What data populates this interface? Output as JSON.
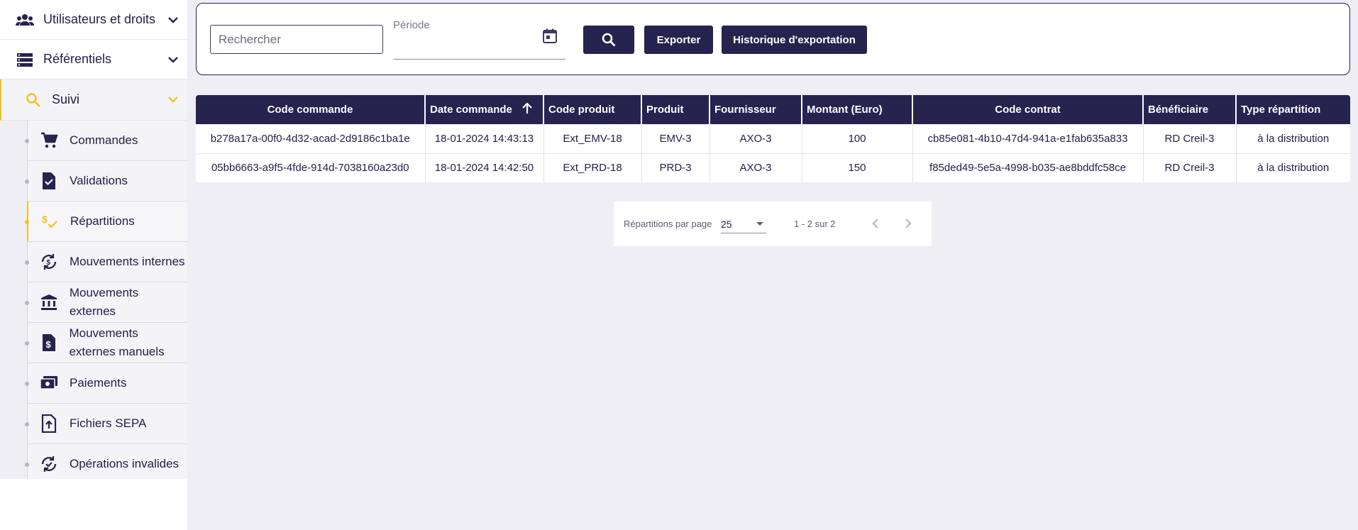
{
  "sidebar": {
    "groups": [
      {
        "label": "Utilisateurs et droits",
        "icon": "users-icon"
      },
      {
        "label": "Référentiels",
        "icon": "list-icon"
      },
      {
        "label": "Suivi",
        "icon": "search-icon"
      }
    ],
    "items": [
      {
        "label": "Commandes",
        "icon": "cart-icon"
      },
      {
        "label": "Validations",
        "icon": "document-check-icon"
      },
      {
        "label": "Répartitions",
        "icon": "distribution-icon"
      },
      {
        "label": "Mouvements internes",
        "icon": "exchange-icon"
      },
      {
        "label": "Mouvements externes",
        "icon": "bank-icon"
      },
      {
        "label": "Mouvements externes manuels",
        "icon": "money-file-icon"
      },
      {
        "label": "Paiements",
        "icon": "payment-icon"
      },
      {
        "label": "Fichiers SEPA",
        "icon": "file-upload-icon"
      },
      {
        "label": "Opérations invalides",
        "icon": "refresh-check-icon"
      }
    ]
  },
  "filter": {
    "search_placeholder": "Rechercher",
    "period_label": "Période",
    "export_label": "Exporter",
    "history_label": "Historique d'exportation"
  },
  "table": {
    "columns": [
      "Code commande",
      "Date commande",
      "Code produit",
      "Produit",
      "Fournisseur",
      "Montant (Euro)",
      "Code contrat",
      "Bénéficiaire",
      "Type répartition"
    ],
    "rows": [
      [
        "b278a17a-00f0-4d32-acad-2d9186c1ba1e",
        "18-01-2024 14:43:13",
        "Ext_EMV-18",
        "EMV-3",
        "AXO-3",
        "100",
        "cb85e081-4b10-47d4-941a-e1fab635a833",
        "RD Creil-3",
        "à la distribution"
      ],
      [
        "05bb6663-a9f5-4fde-914d-7038160a23d0",
        "18-01-2024 14:42:50",
        "Ext_PRD-18",
        "PRD-3",
        "AXO-3",
        "150",
        "f85ded49-5e5a-4998-b035-ae8bddfc58ce",
        "RD Creil-3",
        "à la distribution"
      ]
    ]
  },
  "pagination": {
    "per_page_label": "Répartitions par page",
    "per_page_value": "25",
    "range": "1 - 2 sur 2"
  },
  "colors": {
    "primary": "#26234f",
    "accent": "#f2c21b",
    "background": "#efeef5"
  }
}
